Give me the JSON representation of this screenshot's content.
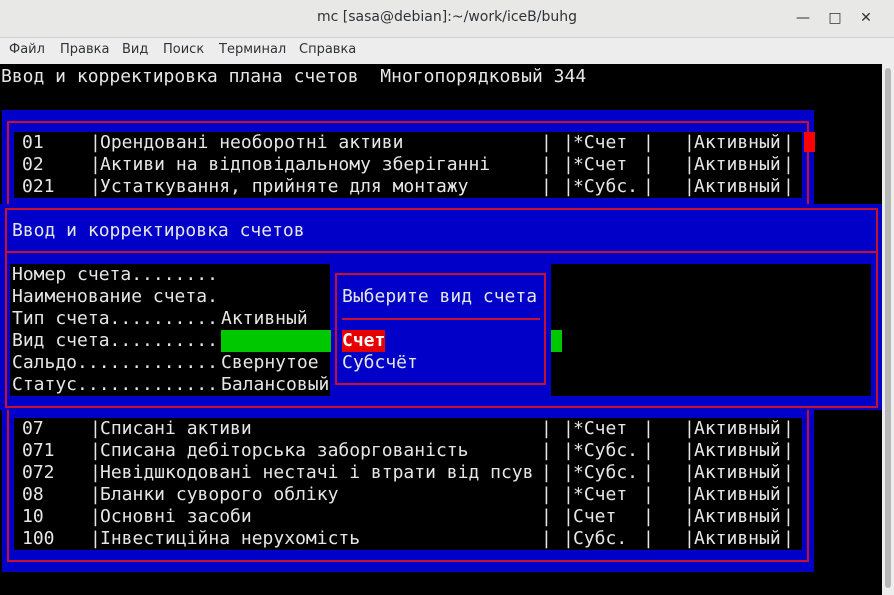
{
  "window": {
    "title": "mc [sasa@debian]:~/work/iceB/buhg",
    "minimize_icon": "minimize-icon",
    "maximize_icon": "maximize-icon",
    "close_icon": "close-icon"
  },
  "menu": {
    "items": [
      "Файл",
      "Правка",
      "Вид",
      "Поиск",
      "Терминал",
      "Справка"
    ]
  },
  "header_line": "Ввод и корректировка плана счетов  Многопорядковый 344",
  "top_rows": [
    {
      "num": "01",
      "name": "Орендовані необоротні активи",
      "type": "*Счет",
      "status": "Активный"
    },
    {
      "num": "02",
      "name": "Активи на відповідальному зберіганні",
      "type": "*Счет",
      "status": "Активный"
    },
    {
      "num": "021",
      "name": "Устаткування, прийняте для монтажу",
      "type": "*Субс.",
      "status": "Активный"
    }
  ],
  "bottom_rows": [
    {
      "num": "07",
      "name": "Списані активи",
      "type": "*Счет",
      "status": "Активный"
    },
    {
      "num": "071",
      "name": "Списана дебіторська заборгованість",
      "type": "*Субс.",
      "status": "Активный"
    },
    {
      "num": "072",
      "name": "Невідшкодовані нестачі і втрати від псув",
      "type": "*Субс.",
      "status": "Активный"
    },
    {
      "num": "08",
      "name": "Бланки суворого обліку",
      "type": "*Счет",
      "status": "Активный"
    },
    {
      "num": "10",
      "name": "Основні засоби",
      "type": "Счет",
      "status": "Активный"
    },
    {
      "num": "100",
      "name": "Інвестиційна нерухомість",
      "type": "Субс.",
      "status": "Активный"
    }
  ],
  "dialog": {
    "title": "Ввод и корректировка счетов",
    "fields": [
      {
        "label": "Номер счета........",
        "value": ""
      },
      {
        "label": "Наименование счета.",
        "value": ""
      },
      {
        "label": "Тип счета..........",
        "value": "Активный"
      },
      {
        "label": "Вид счета..........",
        "value": ""
      },
      {
        "label": "Сальдо.............",
        "value": "Свернутое"
      },
      {
        "label": "Статус.............",
        "value": "Балансовый"
      }
    ]
  },
  "chooser": {
    "title": "Выберите вид счета",
    "options": [
      "Счет",
      "Субсчёт"
    ],
    "selected": 0
  },
  "colors": {
    "panel_blue": "#0000c8",
    "frame_red": "#c8102e",
    "highlight_green": "#00c800",
    "selected_red": "#e60000"
  }
}
